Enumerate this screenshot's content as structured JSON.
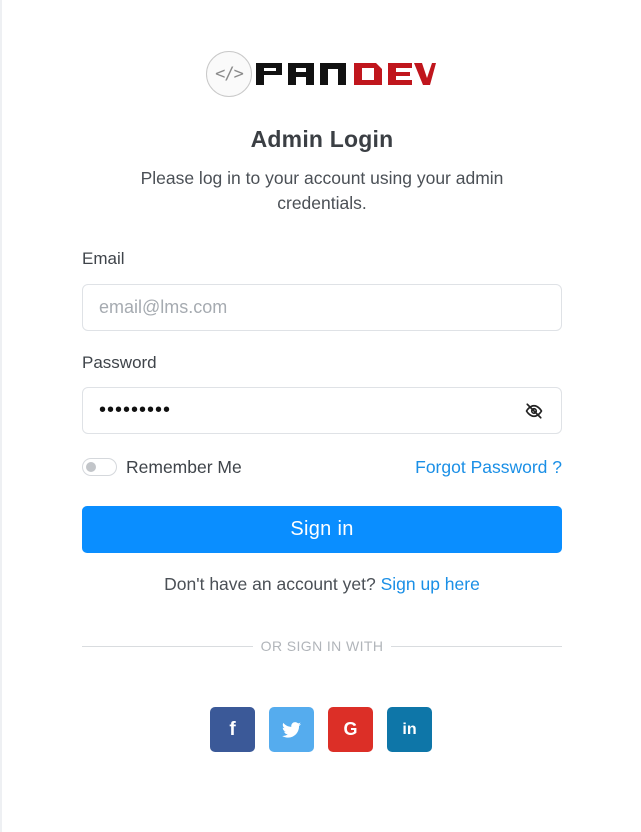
{
  "logo": {
    "badge_text": "</>",
    "wordmark": "PANDEV",
    "colors": {
      "dark": "#111111",
      "accent": "#c0161d"
    }
  },
  "header": {
    "title": "Admin Login",
    "subtitle": "Please log in to your account using your admin credentials."
  },
  "form": {
    "email_label": "Email",
    "email_placeholder": "email@lms.com",
    "email_value": "",
    "password_label": "Password",
    "password_value": "•••••••••",
    "password_toggle_icon": "eye-off-icon",
    "remember_label": "Remember Me",
    "remember_checked": false,
    "forgot_label": "Forgot Password ?",
    "submit_label": "Sign in"
  },
  "signup": {
    "prompt": "Don't have an account yet?",
    "link": "Sign up here"
  },
  "divider": {
    "text": "OR SIGN IN WITH"
  },
  "social": [
    {
      "name": "facebook",
      "glyph": "f",
      "color": "#3b5998"
    },
    {
      "name": "twitter",
      "icon": "twitter-bird-icon",
      "color": "#55acee"
    },
    {
      "name": "google",
      "glyph": "G",
      "color": "#dc2f27"
    },
    {
      "name": "linkedin",
      "glyph": "in",
      "color": "#0e76a8"
    }
  ],
  "colors": {
    "primary": "#0a8eff",
    "link": "#1a8fe6"
  }
}
